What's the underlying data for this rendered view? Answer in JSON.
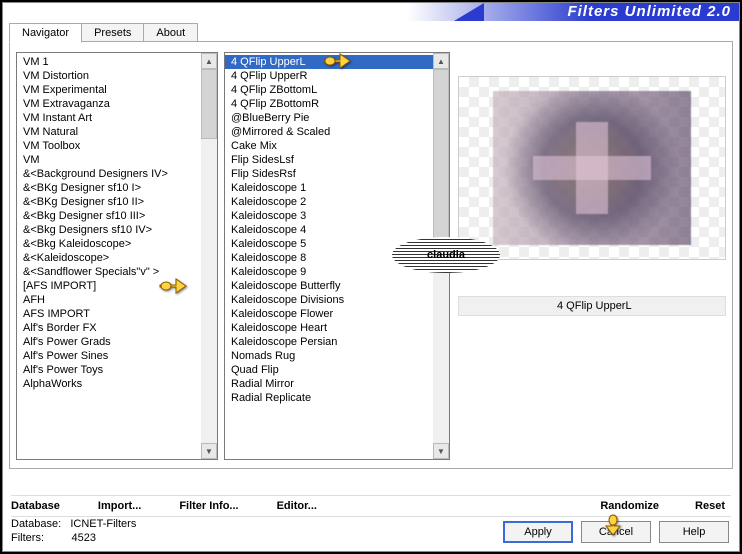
{
  "header": {
    "title": "Filters Unlimited 2.0"
  },
  "tabs": {
    "navigator": "Navigator",
    "presets": "Presets",
    "about": "About"
  },
  "left_list": [
    "VM 1",
    "VM Distortion",
    "VM Experimental",
    "VM Extravaganza",
    "VM Instant Art",
    "VM Natural",
    "VM Toolbox",
    "VM",
    "&<Background Designers IV>",
    "&<BKg Designer sf10 I>",
    "&<BKg Designer sf10 II>",
    "&<Bkg Designer sf10 III>",
    "&<Bkg Designers sf10 IV>",
    "&<Bkg Kaleidoscope>",
    "&<Kaleidoscope>",
    "&<Sandflower Specials\"v\" >",
    "[AFS IMPORT]",
    "AFH",
    "AFS IMPORT",
    "Alf's Border FX",
    "Alf's Power Grads",
    "Alf's Power Sines",
    "Alf's Power Toys",
    "AlphaWorks"
  ],
  "right_list": [
    "4 QFlip UpperL",
    "4 QFlip UpperR",
    "4 QFlip ZBottomL",
    "4 QFlip ZBottomR",
    "@BlueBerry Pie",
    "@Mirrored & Scaled",
    "Cake Mix",
    "Flip SidesLsf",
    "Flip SidesRsf",
    "Kaleidoscope 1",
    "Kaleidoscope 2",
    "Kaleidoscope 3",
    "Kaleidoscope 4",
    "Kaleidoscope 5",
    "Kaleidoscope 8",
    "Kaleidoscope 9",
    "Kaleidoscope Butterfly",
    "Kaleidoscope Divisions",
    "Kaleidoscope Flower",
    "Kaleidoscope Heart",
    "Kaleidoscope Persian",
    "Nomads Rug",
    "Quad Flip",
    "Radial Mirror",
    "Radial Replicate"
  ],
  "selected_filter": "4 QFlip UpperL",
  "links": {
    "database": "Database",
    "import": "Import...",
    "filter_info": "Filter Info...",
    "editor": "Editor...",
    "randomize": "Randomize",
    "reset": "Reset"
  },
  "status": {
    "db_label": "Database:",
    "db_value": "ICNET-Filters",
    "filters_label": "Filters:",
    "filters_value": "4523"
  },
  "buttons": {
    "apply": "Apply",
    "cancel": "Cancel",
    "help": "Help"
  },
  "watermark": "claudia"
}
